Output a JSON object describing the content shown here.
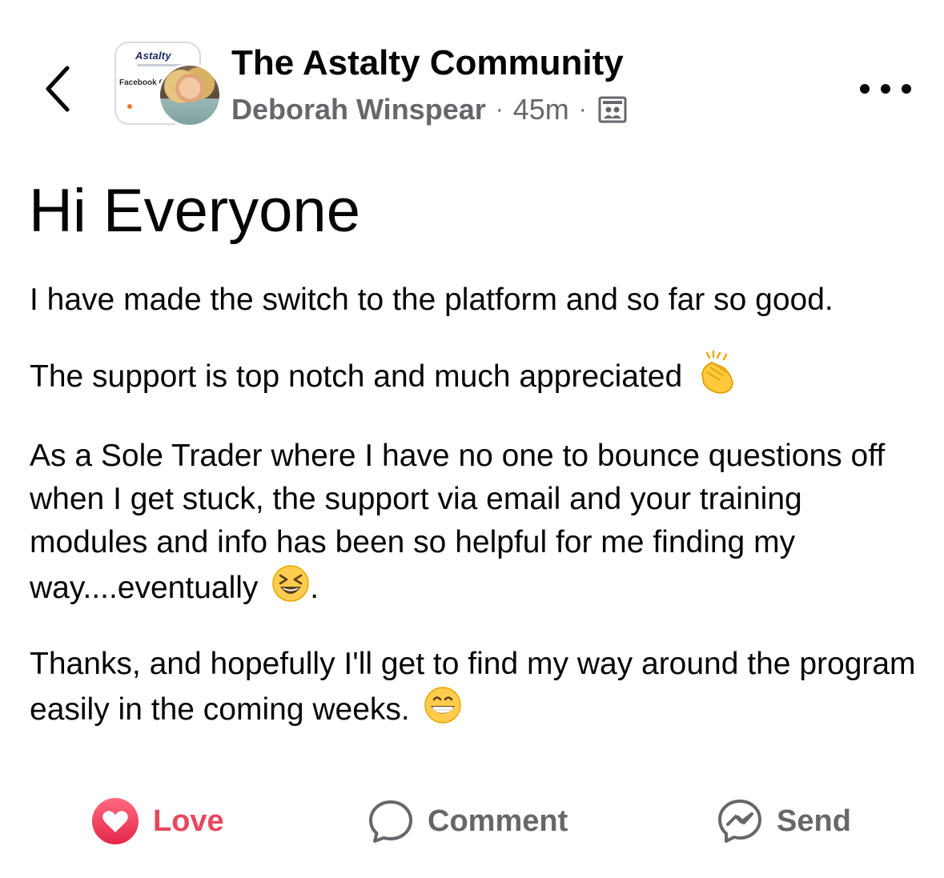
{
  "header": {
    "group_name": "The Astalty Community",
    "author": "Deborah Winspear",
    "separator": "·",
    "time": "45m",
    "group_avatar": {
      "logo_text": "Astalty",
      "label": "Facebook C"
    },
    "icons": {
      "back": "chevron-left-icon",
      "audience": "group-members-icon",
      "more": "more-options-icon"
    }
  },
  "post": {
    "title": "Hi Everyone",
    "paragraphs": [
      {
        "text": "I have made the switch to the platform and so far so good.",
        "emoji": "",
        "trail": ""
      },
      {
        "text": "The support is top notch and much appreciated",
        "emoji": "clapping-hands-emoji",
        "trail": ""
      },
      {
        "text": "As a Sole Trader where I have no one to bounce questions off when I get stuck, the support via email and your training modules and info has been so helpful for me finding my way....eventually",
        "emoji": "laughing-squint-emoji",
        "trail": "."
      },
      {
        "text": "Thanks, and hopefully I'll get to find my way around the program easily in the coming weeks.",
        "emoji": "grinning-emoji",
        "trail": ""
      }
    ]
  },
  "actions": {
    "love": {
      "label": "Love",
      "icon": "heart-icon",
      "color": "#e8475f"
    },
    "comment": {
      "label": "Comment",
      "icon": "comment-bubble-icon",
      "color": "#65676b"
    },
    "send": {
      "label": "Send",
      "icon": "messenger-icon",
      "color": "#65676b"
    }
  }
}
